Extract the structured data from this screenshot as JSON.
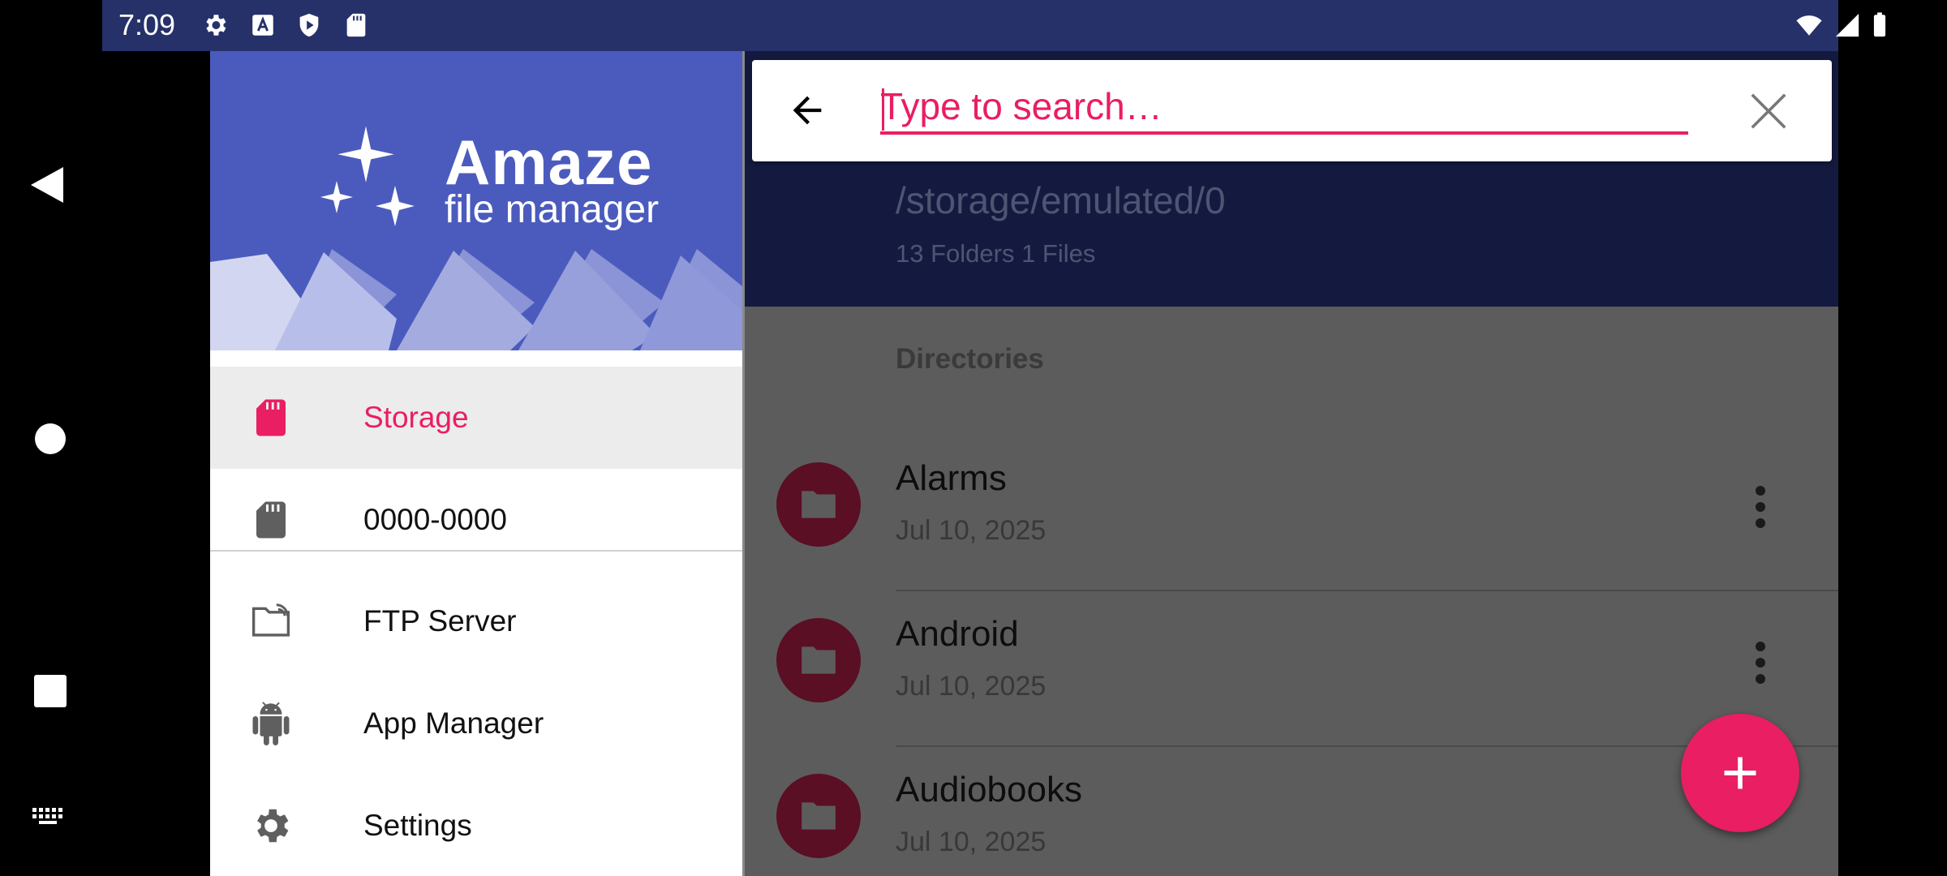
{
  "status_bar": {
    "time": "7:09"
  },
  "drawer": {
    "logo_title": "Amaze",
    "logo_subtitle": "file manager",
    "items": [
      {
        "label": "Storage",
        "icon": "sd-card-icon",
        "active": true
      },
      {
        "label": "0000-0000",
        "icon": "sd-card-icon"
      },
      {
        "label": "FTP Server",
        "icon": "ftp-folder-icon"
      },
      {
        "label": "App Manager",
        "icon": "android-icon"
      },
      {
        "label": "Settings",
        "icon": "gear-icon"
      }
    ]
  },
  "search": {
    "placeholder": "Type to search…"
  },
  "path": {
    "current": "/storage/emulated/0",
    "summary": "13 Folders 1 Files"
  },
  "list": {
    "section_label": "Directories",
    "items": [
      {
        "name": "Alarms",
        "date": "Jul 10, 2025"
      },
      {
        "name": "Android",
        "date": "Jul 10, 2025"
      },
      {
        "name": "Audiobooks",
        "date": "Jul 10, 2025"
      }
    ]
  },
  "colors": {
    "accent": "#e91e63",
    "primary": "#4b5bbd",
    "status_bar": "#26316a"
  }
}
